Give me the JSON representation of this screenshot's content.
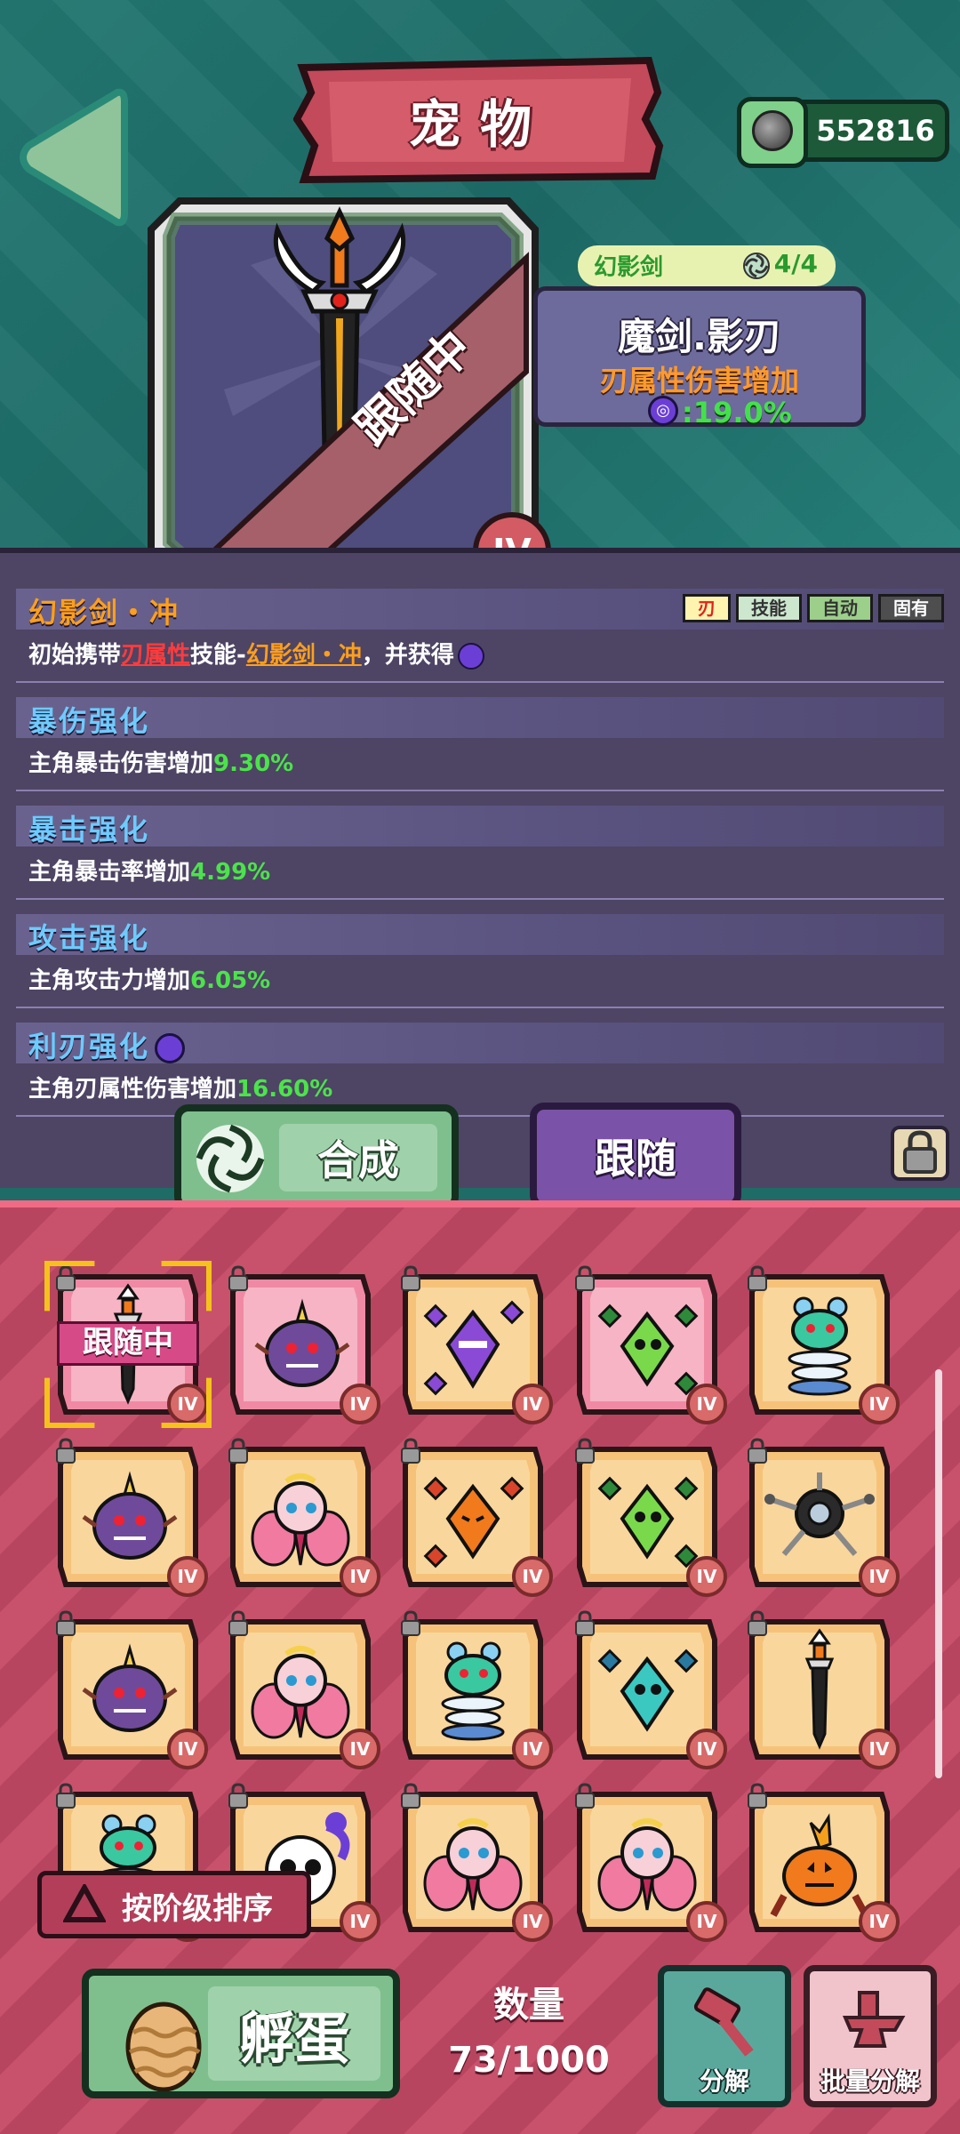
{
  "header": {
    "title": "宠物",
    "currency_value": "552816"
  },
  "pet": {
    "set_name": "幻影剑",
    "set_progress": "4/4",
    "name": "魔剑.影刃",
    "bonus_desc": "刃属性伤害增加",
    "bonus_value": ":19.0%",
    "status_ribbon": "跟随中",
    "tier": "IV"
  },
  "abilities": [
    {
      "title": "幻影剑・冲",
      "desc_prefix": "初始携带",
      "desc_attr": "刃属性",
      "desc_mid": "技能-",
      "desc_skill": "幻影剑・冲",
      "desc_suffix": "，并获得",
      "tags": [
        "刃",
        "技能",
        "自动",
        "固有"
      ]
    },
    {
      "title": "暴伤强化",
      "desc": "主角暴击伤害增加",
      "value": "9.30%"
    },
    {
      "title": "暴击强化",
      "desc": "主角暴击率增加",
      "value": "4.99%"
    },
    {
      "title": "攻击强化",
      "desc": "主角攻击力增加",
      "value": "6.05%"
    },
    {
      "title": "利刃强化",
      "desc": "主角刃属性伤害增加",
      "value": "16.60%"
    }
  ],
  "buttons": {
    "synthesize": "合成",
    "follow": "跟随",
    "sort": "按阶级排序",
    "hatch": "孵蛋",
    "decompose": "分解",
    "batch_decompose": "批量分解"
  },
  "inventory": {
    "count_label": "数量",
    "count_value": "73/1000",
    "following_label": "跟随中",
    "tier_badge": "IV",
    "pets": [
      {
        "icon": "sword-icon",
        "bg": "pink"
      },
      {
        "icon": "purple-blob-icon",
        "bg": "pink"
      },
      {
        "icon": "purple-crystal-icon",
        "bg": "orange"
      },
      {
        "icon": "green-crystal-icon",
        "bg": "pink"
      },
      {
        "icon": "spring-ghost-icon",
        "bg": "orange"
      },
      {
        "icon": "purple-blob-icon",
        "bg": "orange"
      },
      {
        "icon": "fairy-icon",
        "bg": "orange"
      },
      {
        "icon": "orange-crystal-icon",
        "bg": "orange"
      },
      {
        "icon": "green-crystal-icon",
        "bg": "orange"
      },
      {
        "icon": "drone-icon",
        "bg": "orange"
      },
      {
        "icon": "purple-blob-icon",
        "bg": "orange"
      },
      {
        "icon": "fairy-icon",
        "bg": "orange"
      },
      {
        "icon": "spring-ghost-icon",
        "bg": "orange"
      },
      {
        "icon": "teal-crystal-icon",
        "bg": "orange"
      },
      {
        "icon": "sword-icon",
        "bg": "orange"
      },
      {
        "icon": "spring-ghost-icon",
        "bg": "orange"
      },
      {
        "icon": "skull-icon",
        "bg": "orange"
      },
      {
        "icon": "fairy-icon",
        "bg": "orange"
      },
      {
        "icon": "fairy-icon",
        "bg": "orange"
      },
      {
        "icon": "pumpkin-icon",
        "bg": "orange"
      }
    ]
  },
  "colors": {
    "top_bg": "#1f6b66",
    "panel_bg": "#4e4464",
    "bottom_bg": "#c14a63",
    "accent_green": "#44e04c",
    "accent_orange": "#ff9a2e"
  }
}
